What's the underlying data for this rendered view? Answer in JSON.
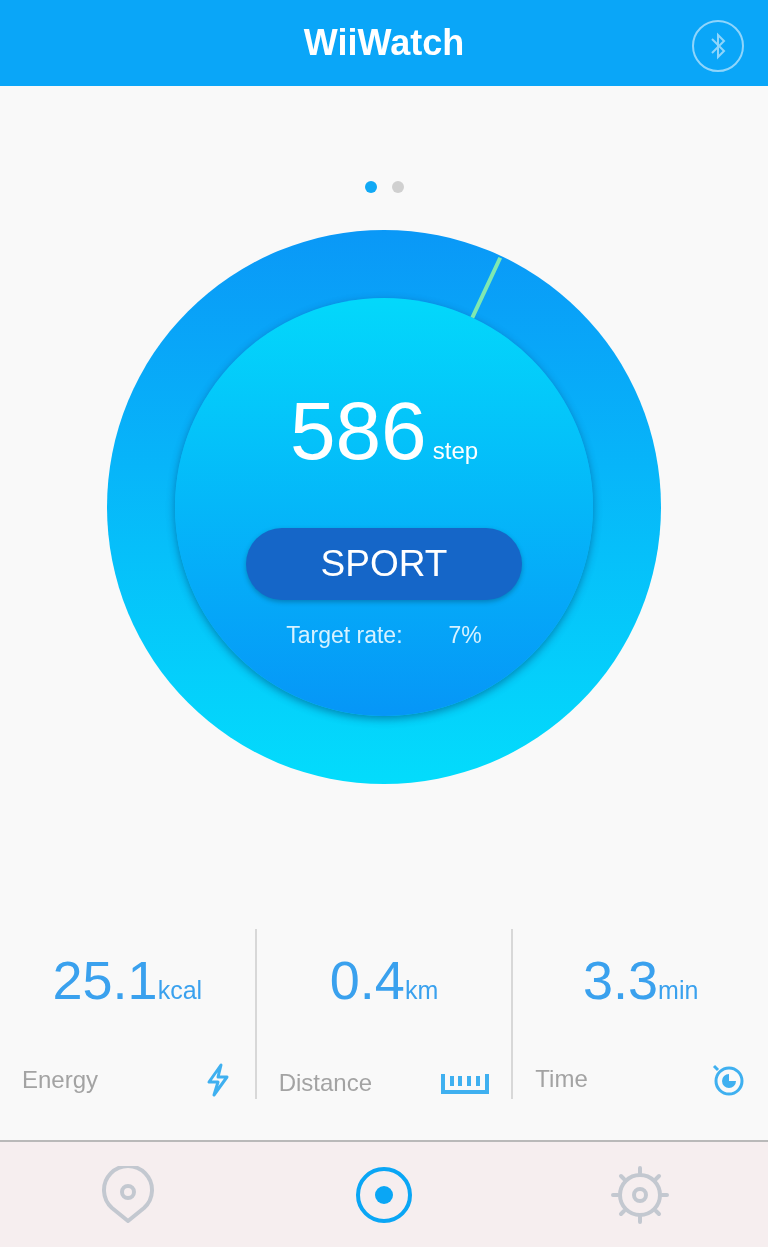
{
  "header": {
    "title": "WiiWatch"
  },
  "pager": [
    {
      "selected": true
    },
    {
      "selected": false
    }
  ],
  "ring": {
    "steps": "586",
    "unit": "step",
    "button": "SPORT",
    "target_label": "Target rate:",
    "target_value": "7%"
  },
  "stats": [
    {
      "kind": "energy",
      "value": "25.1",
      "unit": "kcal",
      "label": "Energy"
    },
    {
      "kind": "distance",
      "value": "0.4",
      "unit": "km",
      "label": "Distance"
    },
    {
      "kind": "time",
      "value": "3.3",
      "unit": "min",
      "label": "Time"
    }
  ],
  "nav": [
    {
      "kind": "location",
      "selected": false
    },
    {
      "kind": "home",
      "selected": true
    },
    {
      "kind": "settings",
      "selected": false
    }
  ]
}
